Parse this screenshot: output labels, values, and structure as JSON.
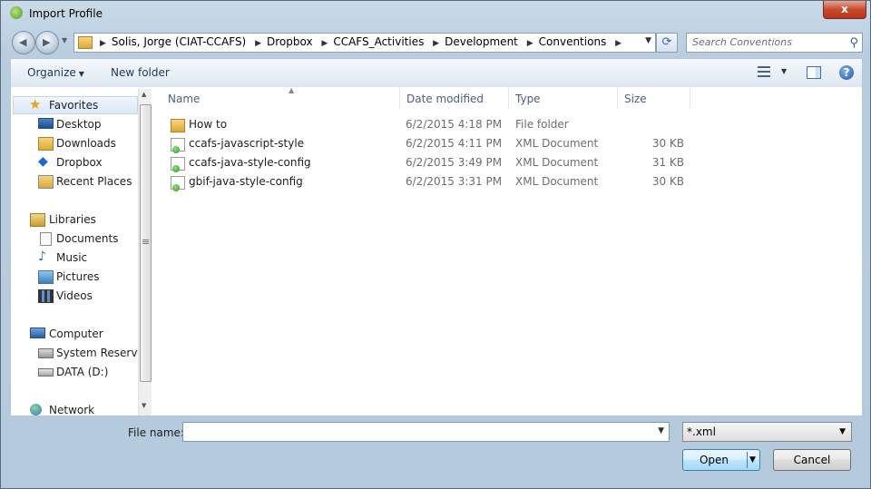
{
  "window": {
    "title": "Import Profile",
    "close_label": "x"
  },
  "address_bar": {
    "crumbs": [
      "Solis, Jorge (CIAT-CCAFS)",
      "Dropbox",
      "CCAFS_Activities",
      "Development",
      "Conventions"
    ]
  },
  "search": {
    "placeholder": "Search Conventions"
  },
  "toolbar": {
    "organize_label": "Organize",
    "new_folder_label": "New folder",
    "help_label": "?"
  },
  "nav": {
    "favorites_label": "Favorites",
    "favorites": [
      "Desktop",
      "Downloads",
      "Dropbox",
      "Recent Places"
    ],
    "libraries_label": "Libraries",
    "libraries": [
      "Documents",
      "Music",
      "Pictures",
      "Videos"
    ],
    "computer_label": "Computer",
    "computer": [
      "System Reserved",
      "DATA (D:)"
    ],
    "network_label": "Network"
  },
  "columns": {
    "name": "Name",
    "date": "Date modified",
    "type": "Type",
    "size": "Size"
  },
  "files": [
    {
      "name": "How to",
      "date": "6/2/2015 4:18 PM",
      "type": "File folder",
      "size": "",
      "icon": "folder-icon"
    },
    {
      "name": "ccafs-javascript-style",
      "date": "6/2/2015 4:11 PM",
      "type": "XML Document",
      "size": "30 KB",
      "icon": "xml-file-icon"
    },
    {
      "name": "ccafs-java-style-config",
      "date": "6/2/2015 3:49 PM",
      "type": "XML Document",
      "size": "31 KB",
      "icon": "xml-file-icon"
    },
    {
      "name": "gbif-java-style-config",
      "date": "6/2/2015 3:31 PM",
      "type": "XML Document",
      "size": "30 KB",
      "icon": "xml-file-icon"
    }
  ],
  "bottom": {
    "file_name_label": "File name:",
    "file_name_value": "",
    "file_type_value": "*.xml",
    "open_label": "Open",
    "cancel_label": "Cancel"
  }
}
